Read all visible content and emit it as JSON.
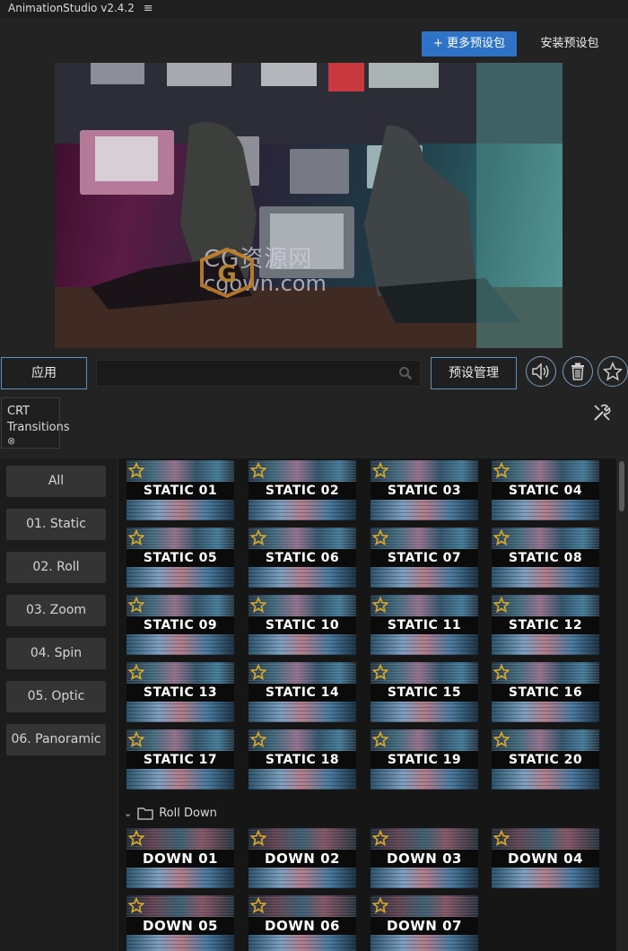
{
  "app": {
    "title": "AnimationStudio v2.4.2",
    "menu_glyph": "≡"
  },
  "header": {
    "more_presets_label": "+ 更多预设包",
    "install_presets_label": "安装预设包"
  },
  "watermark": {
    "line1": "CG资源网",
    "line2": "cgown.com"
  },
  "toolbar": {
    "apply_label": "应用",
    "search_value": "",
    "search_placeholder": "",
    "manage_label": "预设管理"
  },
  "pack_tab": {
    "label": "CRT Transitions",
    "close_glyph": "⊗"
  },
  "categories": [
    "All",
    "01. Static",
    "02. Roll",
    "03. Zoom",
    "04. Spin",
    "05. Optic",
    "06. Panoramic"
  ],
  "static_presets": [
    "STATIC 01",
    "STATIC 02",
    "STATIC 03",
    "STATIC 04",
    "STATIC 05",
    "STATIC 06",
    "STATIC 07",
    "STATIC 08",
    "STATIC 09",
    "STATIC 10",
    "STATIC 11",
    "STATIC 12",
    "STATIC 13",
    "STATIC 14",
    "STATIC 15",
    "STATIC 16",
    "STATIC 17",
    "STATIC 18",
    "STATIC 19",
    "STATIC 20"
  ],
  "roll_folder": {
    "name": "Roll Down",
    "chevron": "⌄"
  },
  "roll_presets": [
    "DOWN 01",
    "DOWN 02",
    "DOWN 03",
    "DOWN 04",
    "DOWN 05",
    "DOWN 06",
    "DOWN 07"
  ],
  "colors": {
    "accent": "#2f73c9",
    "outline": "#5d8fc0",
    "star": "#d8a928",
    "background": "#232323"
  },
  "icons": [
    "menu-icon",
    "search-icon",
    "volume-icon",
    "trash-icon",
    "star-icon",
    "tools-icon",
    "folder-icon",
    "chevron-down-icon"
  ]
}
